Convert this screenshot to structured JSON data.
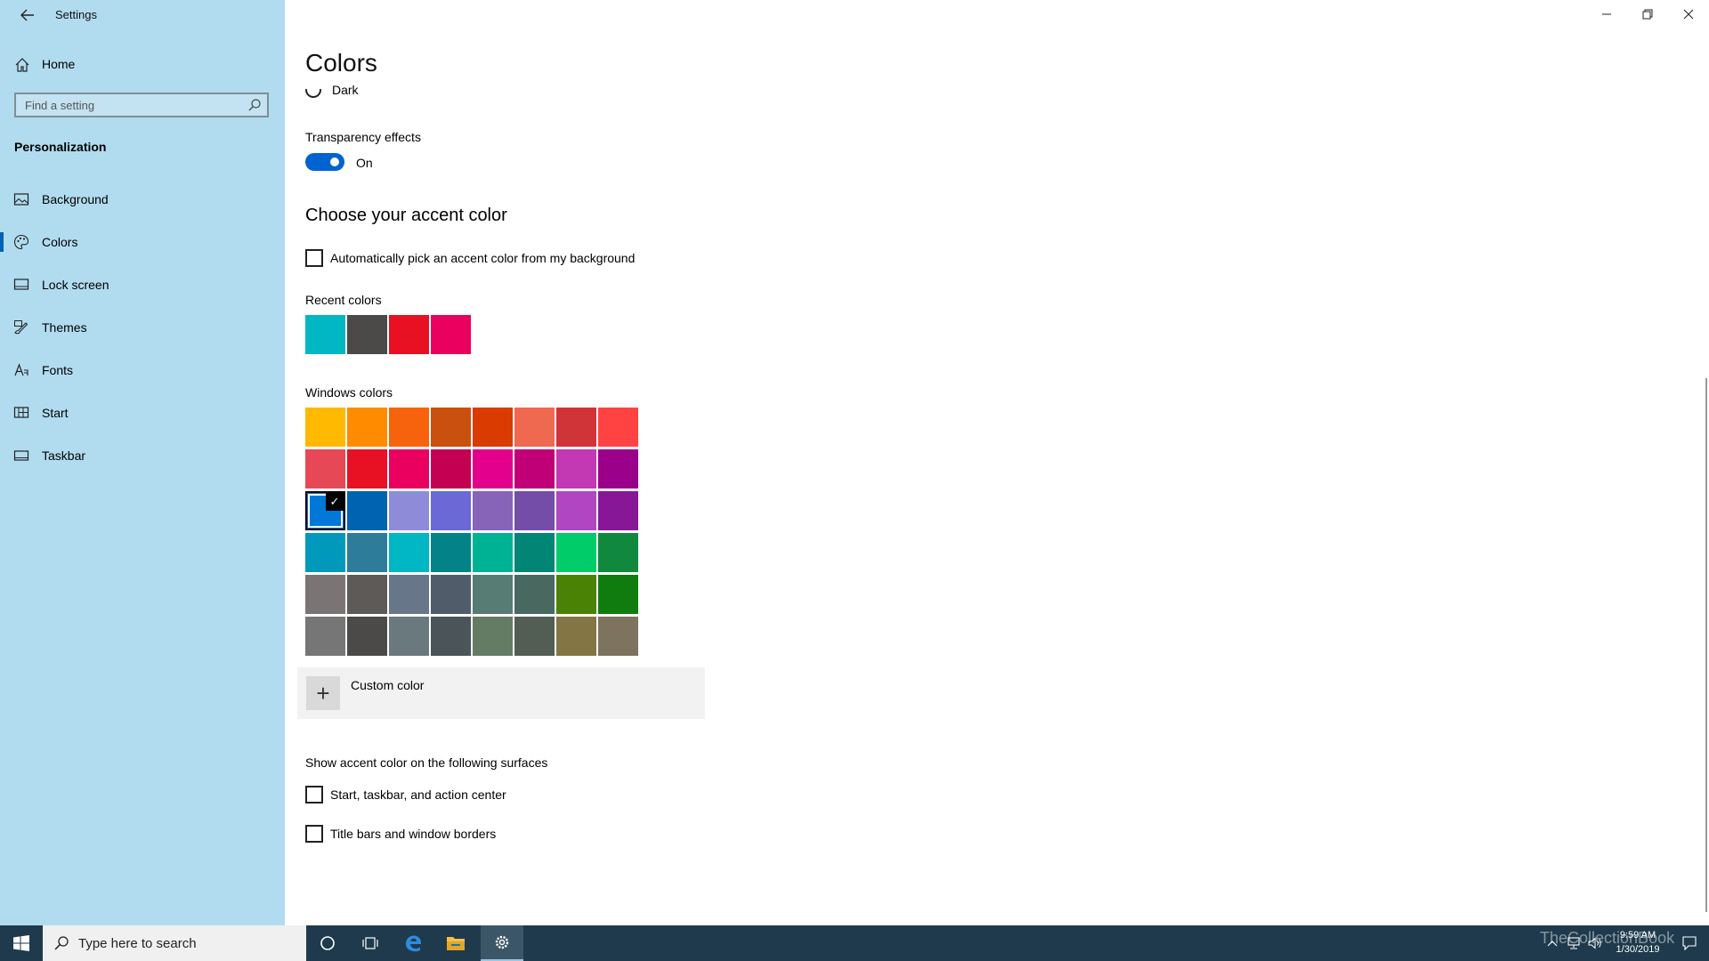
{
  "window": {
    "app_title": "Settings",
    "controls": {
      "minimize": "—",
      "restore": "❐",
      "close": "✕"
    }
  },
  "sidebar": {
    "home_label": "Home",
    "search_placeholder": "Find a setting",
    "section": "Personalization",
    "items": [
      {
        "label": "Background",
        "icon": "image-icon",
        "selected": false
      },
      {
        "label": "Colors",
        "icon": "palette-icon",
        "selected": true
      },
      {
        "label": "Lock screen",
        "icon": "lock-screen-icon",
        "selected": false
      },
      {
        "label": "Themes",
        "icon": "brush-icon",
        "selected": false
      },
      {
        "label": "Fonts",
        "icon": "font-icon",
        "selected": false
      },
      {
        "label": "Start",
        "icon": "start-menu-icon",
        "selected": false
      },
      {
        "label": "Taskbar",
        "icon": "taskbar-icon",
        "selected": false
      }
    ]
  },
  "main": {
    "title": "Colors",
    "mode_option": "Dark",
    "transparency": {
      "label": "Transparency effects",
      "state": "On",
      "on": true
    },
    "accent_heading": "Choose your accent color",
    "auto_pick_label": "Automatically pick an accent color from my background",
    "recent_label": "Recent colors",
    "recent_colors": [
      "#00b7c3",
      "#4c4a48",
      "#e81123",
      "#ea005e"
    ],
    "windows_colors_label": "Windows colors",
    "windows_colors": [
      [
        "#ffb900",
        "#ff8c00",
        "#f7630c",
        "#ca5010",
        "#da3b01",
        "#ef6950",
        "#d13438",
        "#ff4343"
      ],
      [
        "#e74856",
        "#e81123",
        "#ea005e",
        "#c30052",
        "#e3008c",
        "#bf0077",
        "#c239b3",
        "#9a0089"
      ],
      [
        "#0078d7",
        "#0063b1",
        "#8e8cd8",
        "#6b69d6",
        "#8764b8",
        "#744da9",
        "#b146c2",
        "#881798"
      ],
      [
        "#0099bc",
        "#2d7d9a",
        "#00b7c3",
        "#038387",
        "#00b294",
        "#018574",
        "#00cc6a",
        "#10893e"
      ],
      [
        "#7a7574",
        "#5d5a58",
        "#68768a",
        "#515c6b",
        "#567c73",
        "#486860",
        "#498205",
        "#107c10"
      ],
      [
        "#767676",
        "#4c4a48",
        "#69797e",
        "#4a5459",
        "#647c64",
        "#525e54",
        "#847545",
        "#7e735f"
      ]
    ],
    "selected_color": {
      "row": 2,
      "col": 0,
      "check": "✓"
    },
    "custom_color_label": "Custom color",
    "custom_plus": "+",
    "surfaces_heading": "Show accent color on the following surfaces",
    "surface_options": [
      "Start, taskbar, and action center",
      "Title bars and window borders"
    ]
  },
  "taskbar": {
    "search_placeholder": "Type here to search",
    "icons": [
      "cortana-icon",
      "task-view-icon",
      "edge-icon",
      "file-explorer-icon",
      "settings-icon"
    ],
    "clock_time": "9:59 AM",
    "clock_date": "1/30/2019",
    "watermark": "TheCollectionBook"
  }
}
